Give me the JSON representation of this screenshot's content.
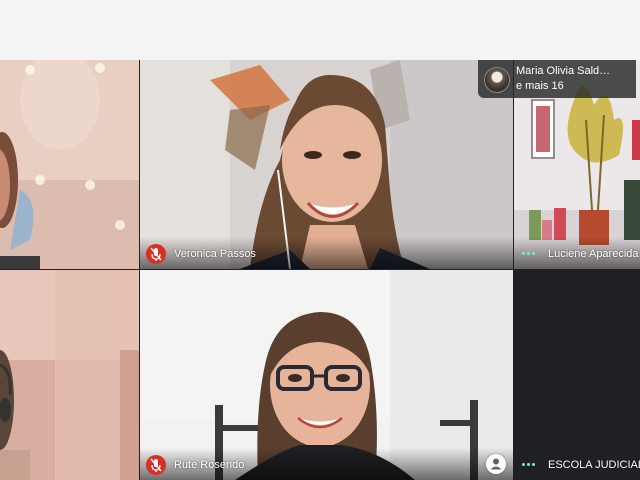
{
  "participants": [
    {
      "name": "Veronica Passos",
      "mic": "off",
      "mic_icon": "mic-off-icon"
    },
    {
      "name": "Luciene Aparecida",
      "status": "speaking",
      "status_icon": "speaking-dots-icon"
    },
    {
      "name": "Rute Rosendo",
      "mic": "off",
      "mic_icon": "mic-off-icon"
    },
    {
      "name": "ESCOLA JUDICIAL",
      "status": "speaking",
      "status_icon": "speaking-dots-icon"
    }
  ],
  "overflow": {
    "name": "Maria Olivia Sald…",
    "more_label": "e mais 16"
  },
  "colors": {
    "mic_off_red": "#d93025",
    "speaking_green": "#7df0b0",
    "grid_background": "#202124"
  }
}
